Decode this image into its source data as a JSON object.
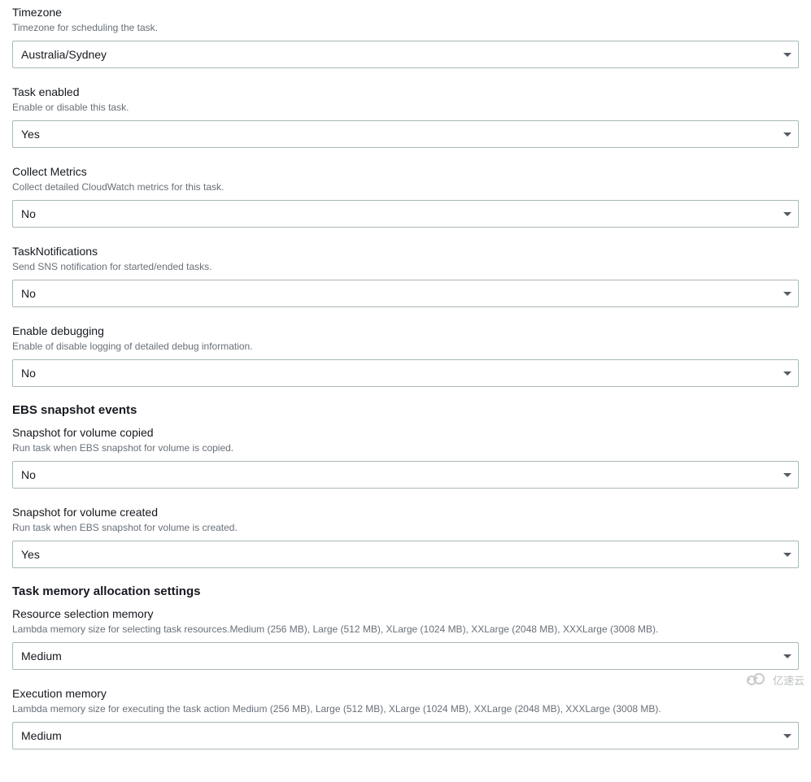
{
  "fields": {
    "timezone": {
      "label": "Timezone",
      "desc": "Timezone for scheduling the task.",
      "value": "Australia/Sydney"
    },
    "task_enabled": {
      "label": "Task enabled",
      "desc": "Enable or disable this task.",
      "value": "Yes"
    },
    "collect_metrics": {
      "label": "Collect Metrics",
      "desc": "Collect detailed CloudWatch metrics for this task.",
      "value": "No"
    },
    "task_notifications": {
      "label": "TaskNotifications",
      "desc": "Send SNS notification for started/ended tasks.",
      "value": "No"
    },
    "enable_debugging": {
      "label": "Enable debugging",
      "desc": "Enable of disable logging of detailed debug information.",
      "value": "No"
    }
  },
  "ebs_section": {
    "title": "EBS snapshot events",
    "snapshot_copied": {
      "label": "Snapshot for volume copied",
      "desc": "Run task when EBS snapshot for volume is copied.",
      "value": "No"
    },
    "snapshot_created": {
      "label": "Snapshot for volume created",
      "desc": "Run task when EBS snapshot for volume is created.",
      "value": "Yes"
    }
  },
  "memory_section": {
    "title": "Task memory allocation settings",
    "resource_memory": {
      "label": "Resource selection memory",
      "desc": "Lambda memory size for selecting task resources.Medium (256 MB), Large (512 MB), XLarge (1024 MB), XXLarge (2048 MB), XXXLarge (3008 MB).",
      "value": "Medium"
    },
    "execution_memory": {
      "label": "Execution memory",
      "desc": "Lambda memory size for executing the task action Medium (256 MB), Large (512 MB), XLarge (1024 MB), XXLarge (2048 MB), XXXLarge (3008 MB).",
      "value": "Medium"
    }
  },
  "watermark": "亿速云"
}
